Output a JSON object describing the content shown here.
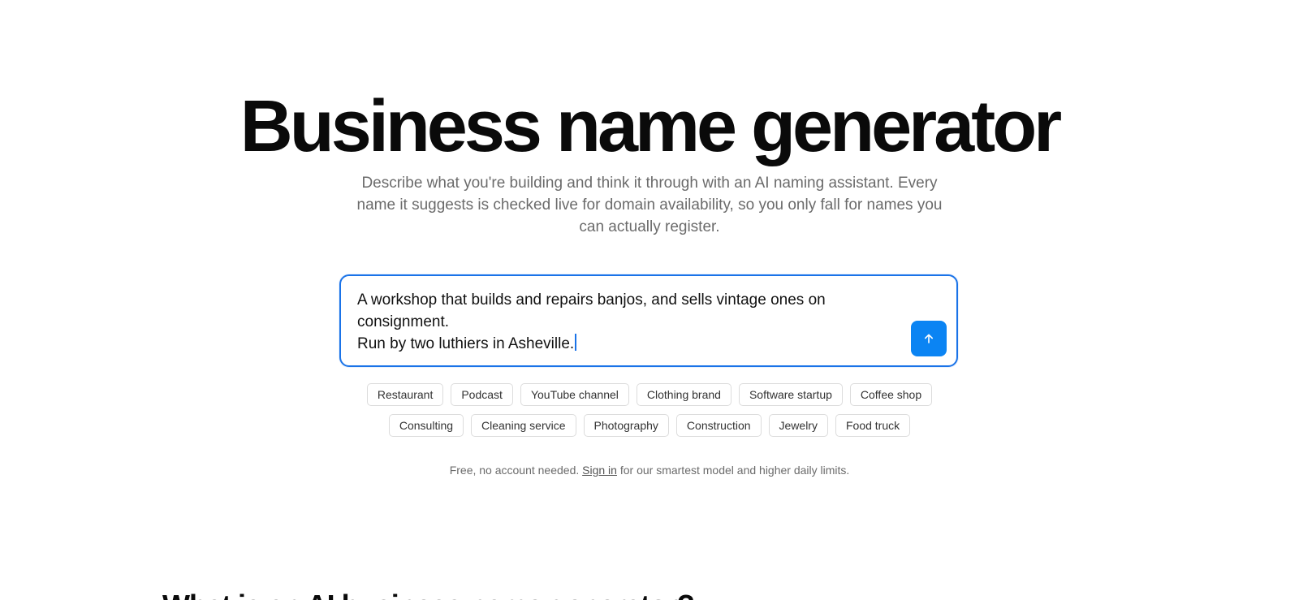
{
  "hero": {
    "title": "Business name generator",
    "subtitle": "Describe what you're building and think it through with an AI naming assistant. Every name it suggests is checked live for domain availability, so you only fall for names you can actually register."
  },
  "prompt": {
    "value": "A workshop that builds and repairs banjos, and sells vintage ones on consignment.\nRun by two luthiers in Asheville.",
    "send_icon": "arrow-up-icon",
    "accent_color": "#1a73e8",
    "send_color": "#0b84f3"
  },
  "chips_row1": [
    "Restaurant",
    "Podcast",
    "YouTube channel",
    "Clothing brand",
    "Software startup",
    "Coffee shop"
  ],
  "chips_row2": [
    "Consulting",
    "Cleaning service",
    "Photography",
    "Construction",
    "Jewelry",
    "Food truck"
  ],
  "footnote": {
    "before": "Free, no account needed. ",
    "link": "Sign in",
    "after": " for our smartest model and higher daily limits."
  },
  "section": {
    "heading": "What is an AI business name generator?"
  }
}
